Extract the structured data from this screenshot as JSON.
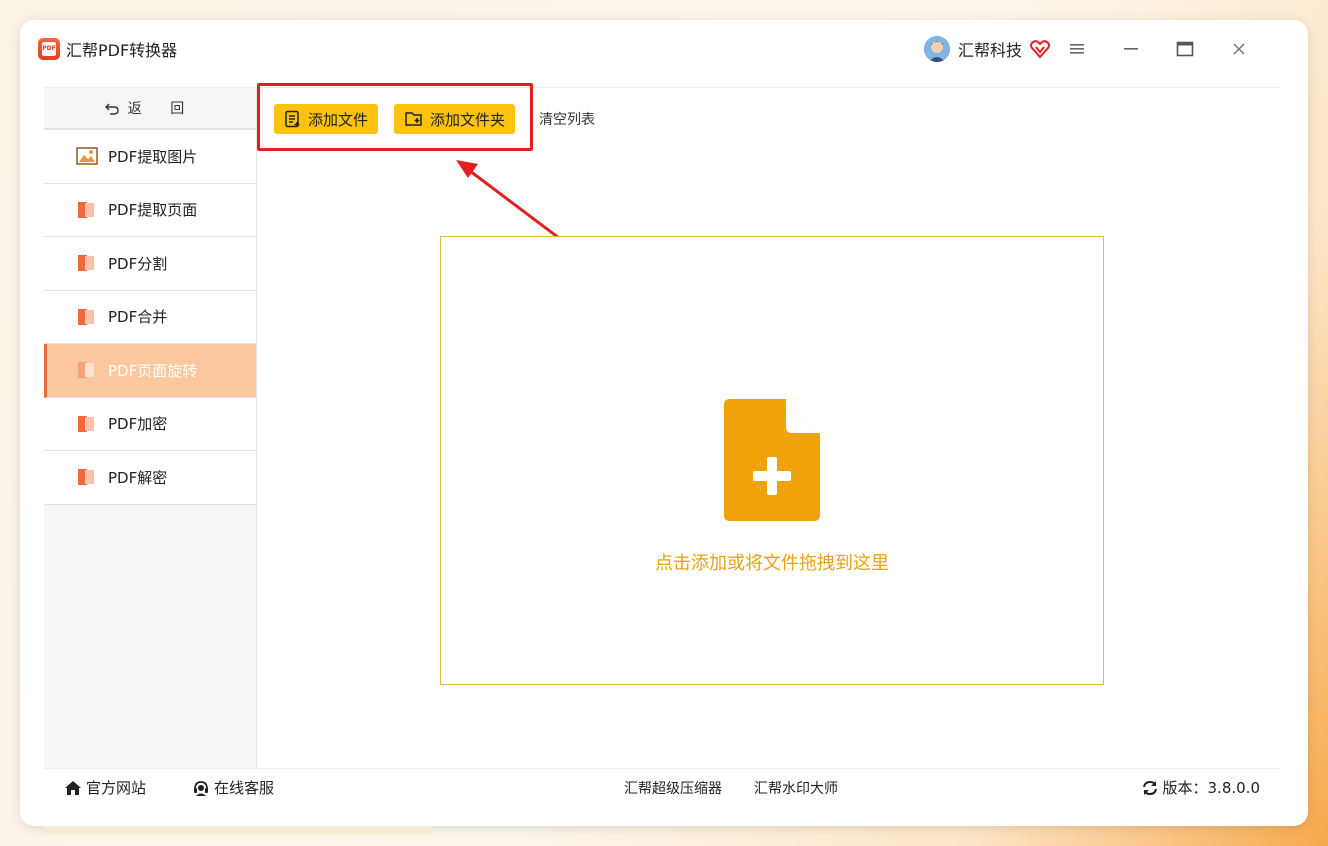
{
  "app": {
    "title": "汇帮PDF转换器",
    "logo_text": "PDF"
  },
  "user": {
    "name": "汇帮科技"
  },
  "window_controls": {
    "menu": "menu-icon",
    "minimize": "minimize-icon",
    "maximize": "maximize-icon",
    "close": "close-icon"
  },
  "sidebar": {
    "back_label": "返 回",
    "items": [
      {
        "label": "PDF提取图片",
        "icon": "image-icon"
      },
      {
        "label": "PDF提取页面",
        "icon": "pdf-file-icon"
      },
      {
        "label": "PDF分割",
        "icon": "pdf-file-icon"
      },
      {
        "label": "PDF合并",
        "icon": "pdf-file-icon"
      },
      {
        "label": "PDF页面旋转",
        "icon": "pdf-file-icon",
        "active": true
      },
      {
        "label": "PDF加密",
        "icon": "pdf-file-icon"
      },
      {
        "label": "PDF解密",
        "icon": "pdf-file-icon"
      }
    ]
  },
  "toolbar": {
    "add_file": "添加文件",
    "add_folder": "添加文件夹",
    "clear_list": "清空列表"
  },
  "dropzone": {
    "hint": "点击添加或将文件拖拽到这里"
  },
  "footer": {
    "website": "官方网站",
    "support": "在线客服",
    "compressor": "汇帮超级压缩器",
    "watermark": "汇帮水印大师",
    "version": "版本：3.8.0.0"
  },
  "colors": {
    "accent": "#ffc20e",
    "active_item": "#fcc79c",
    "highlight_red": "#e2201f",
    "drop_text": "#e8a21a",
    "drop_icon": "#f0a30a"
  }
}
